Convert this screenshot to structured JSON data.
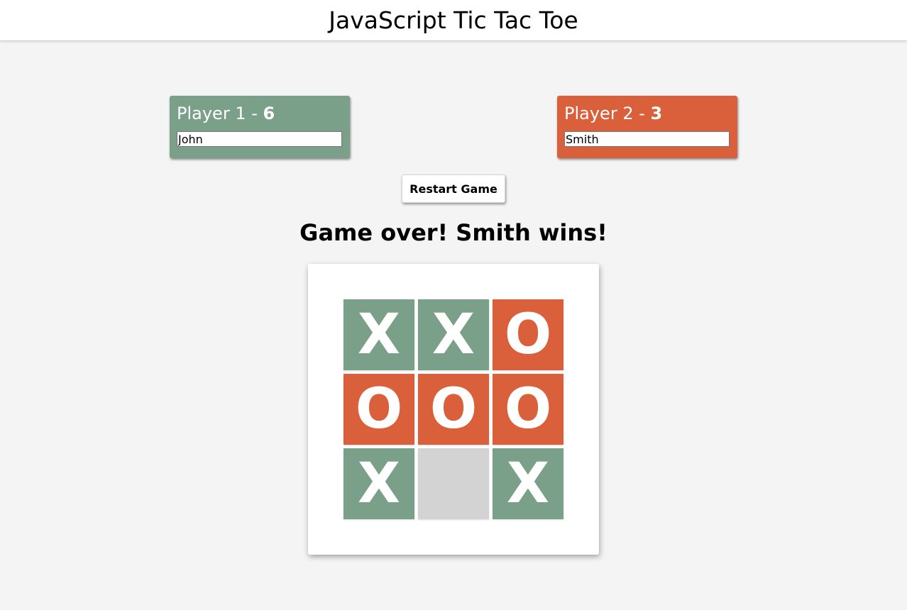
{
  "header": {
    "title": "JavaScript Tic Tac Toe"
  },
  "colors": {
    "player1": "#7ba08a",
    "player2": "#da5f3b",
    "empty": "#d3d3d3"
  },
  "players": [
    {
      "label": "Player 1 - ",
      "score": "6",
      "name": "John"
    },
    {
      "label": "Player 2 - ",
      "score": "3",
      "name": "Smith"
    }
  ],
  "controls": {
    "restart_label": "Restart Game"
  },
  "status": "Game over! Smith wins!",
  "board": {
    "cells": [
      "X",
      "X",
      "O",
      "O",
      "O",
      "O",
      "X",
      "",
      "X"
    ]
  }
}
